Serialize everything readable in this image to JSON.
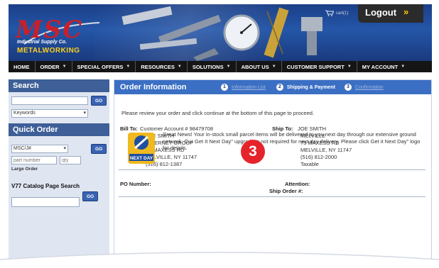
{
  "header": {
    "logo_text": "MSC",
    "logo_subtitle": "Industrial Supply Co.",
    "logo_brand": "METALWORKING",
    "cart_label": "cart(1)",
    "logout_label": "Logout",
    "logout_chevron": "»"
  },
  "nav": {
    "items": [
      {
        "label": "HOME",
        "arrow": ""
      },
      {
        "label": "ORDER",
        "arrow": "▼"
      },
      {
        "label": "SPECIAL OFFERS",
        "arrow": "▼"
      },
      {
        "label": "RESOURCES",
        "arrow": "▼"
      },
      {
        "label": "SOLUTIONS",
        "arrow": "▼"
      },
      {
        "label": "ABOUT US",
        "arrow": "▼"
      },
      {
        "label": "CUSTOMER SUPPORT",
        "arrow": "▼"
      },
      {
        "label": "MY ACCOUNT",
        "arrow": "▼"
      }
    ]
  },
  "sidebar": {
    "search_title": "Search",
    "search_value": "",
    "go_label": "GO",
    "search_type": "Keywords",
    "quick_order_title": "Quick Order",
    "quick_type": "MSC/J#",
    "part_placeholder": "part number",
    "qty_placeholder": "qty",
    "large_order": "Large Order",
    "catalog_label": "V77 Catalog Page Search",
    "catalog_value": ""
  },
  "main": {
    "title": "Order Information",
    "steps": [
      {
        "num": "1",
        "label": "Information List",
        "state": "muted"
      },
      {
        "num": "2",
        "label": "Shipping & Payment",
        "state": "active"
      },
      {
        "num": "3",
        "label": "Confirmation",
        "state": "muted"
      }
    ],
    "intro": "Please review your order and click continue at the bottom of this page to proceed.",
    "bill_to": {
      "label": "Bill To:",
      "account": "Customer Account # 98479708",
      "lines": [
        "JOE SMITH",
        "INTERNET GROUP",
        "75 MAXESS RD",
        "MELVILLE, NY 11747",
        "(516) 812-1387"
      ]
    },
    "ship_to": {
      "label": "Ship To:",
      "lines": [
        "JOE SMITH",
        "MELVILLE",
        "75 MAXESS RD",
        "MELVILLE, NY 11747",
        "(516) 812-2000",
        "Taxable"
      ]
    },
    "po_label": "PO Number:",
    "attention_label": "Attention:",
    "ship_order_label": "Ship Order #:",
    "badge": "3",
    "next_day_text": "Great News! Your in-stock small parcel items will be delivered to you next day through our extensive ground network. Our Get It Next Day\" upgrade is not required for next day delivery. Please click Get it Next Day\" logo for details.",
    "next_day_logo": "NEXT DAY"
  },
  "colors": {
    "header_blue": "#1b3f87",
    "panel_blue": "#3b6fc4",
    "logo_red": "#c8202a",
    "badge_red": "#e5232b",
    "brand_yellow": "#ffcf1a"
  }
}
